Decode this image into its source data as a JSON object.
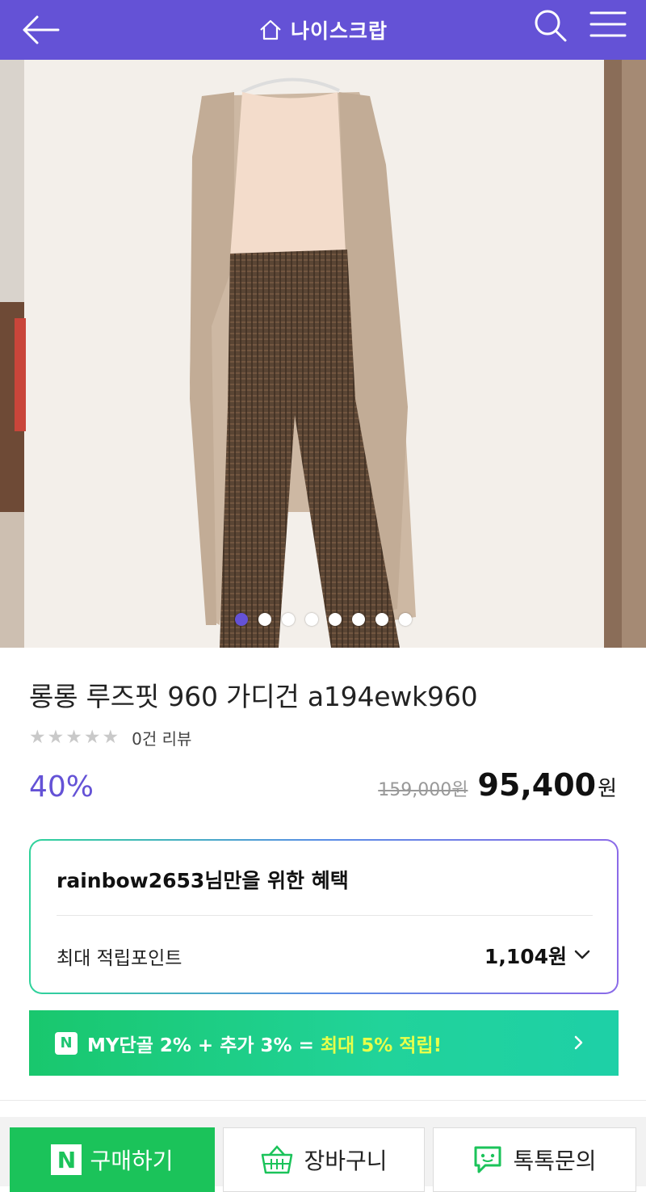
{
  "header": {
    "title": "나이스크랍",
    "back_icon": "arrow-left-icon",
    "home_icon": "home-icon",
    "search_icon": "search-icon",
    "menu_icon": "hamburger-menu-icon",
    "bg_color": "#6452d6"
  },
  "gallery": {
    "image_count": 8,
    "active_index": 0
  },
  "product": {
    "title": "롱롱 루즈핏 960 가디건 a194ewk960",
    "stars": "★★★★★",
    "review_count": "0건 리뷰",
    "discount": "40%",
    "original_price": "159,000원",
    "sale_price": "95,400",
    "currency": "원"
  },
  "benefit": {
    "heading": "rainbow2653님만을 위한 혜택",
    "points_label": "최대 적립포인트",
    "points_value": "1,104원"
  },
  "promo": {
    "badge": "N",
    "text_main": "MY단골 2% + 추가 3% = ",
    "text_highlight": "최대 5% 적립!"
  },
  "actions": {
    "buy_logo": "N",
    "buy_label": "구매하기",
    "cart_label": "장바구니",
    "talk_label": "톡톡문의"
  },
  "colors": {
    "accent": "#6452d6",
    "naver_green": "#1bc35a"
  }
}
